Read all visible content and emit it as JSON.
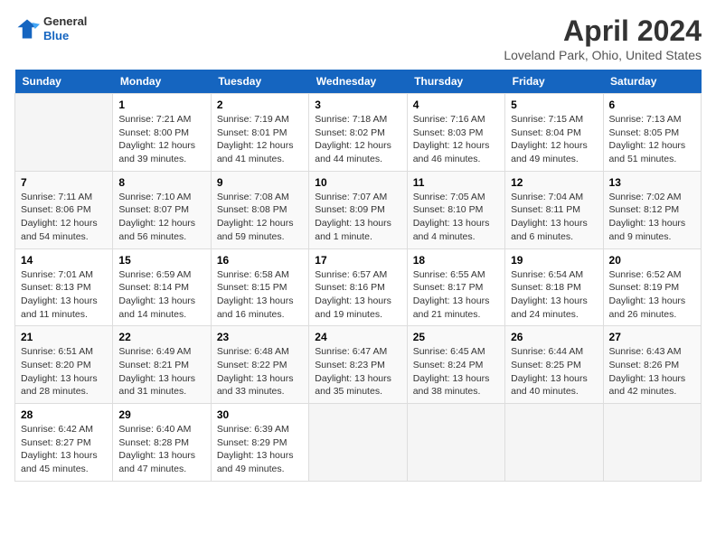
{
  "header": {
    "logo_general": "General",
    "logo_blue": "Blue",
    "title": "April 2024",
    "subtitle": "Loveland Park, Ohio, United States"
  },
  "days_of_week": [
    "Sunday",
    "Monday",
    "Tuesday",
    "Wednesday",
    "Thursday",
    "Friday",
    "Saturday"
  ],
  "weeks": [
    [
      {
        "day": "",
        "sunrise": "",
        "sunset": "",
        "daylight": ""
      },
      {
        "day": "1",
        "sunrise": "Sunrise: 7:21 AM",
        "sunset": "Sunset: 8:00 PM",
        "daylight": "Daylight: 12 hours and 39 minutes."
      },
      {
        "day": "2",
        "sunrise": "Sunrise: 7:19 AM",
        "sunset": "Sunset: 8:01 PM",
        "daylight": "Daylight: 12 hours and 41 minutes."
      },
      {
        "day": "3",
        "sunrise": "Sunrise: 7:18 AM",
        "sunset": "Sunset: 8:02 PM",
        "daylight": "Daylight: 12 hours and 44 minutes."
      },
      {
        "day": "4",
        "sunrise": "Sunrise: 7:16 AM",
        "sunset": "Sunset: 8:03 PM",
        "daylight": "Daylight: 12 hours and 46 minutes."
      },
      {
        "day": "5",
        "sunrise": "Sunrise: 7:15 AM",
        "sunset": "Sunset: 8:04 PM",
        "daylight": "Daylight: 12 hours and 49 minutes."
      },
      {
        "day": "6",
        "sunrise": "Sunrise: 7:13 AM",
        "sunset": "Sunset: 8:05 PM",
        "daylight": "Daylight: 12 hours and 51 minutes."
      }
    ],
    [
      {
        "day": "7",
        "sunrise": "Sunrise: 7:11 AM",
        "sunset": "Sunset: 8:06 PM",
        "daylight": "Daylight: 12 hours and 54 minutes."
      },
      {
        "day": "8",
        "sunrise": "Sunrise: 7:10 AM",
        "sunset": "Sunset: 8:07 PM",
        "daylight": "Daylight: 12 hours and 56 minutes."
      },
      {
        "day": "9",
        "sunrise": "Sunrise: 7:08 AM",
        "sunset": "Sunset: 8:08 PM",
        "daylight": "Daylight: 12 hours and 59 minutes."
      },
      {
        "day": "10",
        "sunrise": "Sunrise: 7:07 AM",
        "sunset": "Sunset: 8:09 PM",
        "daylight": "Daylight: 13 hours and 1 minute."
      },
      {
        "day": "11",
        "sunrise": "Sunrise: 7:05 AM",
        "sunset": "Sunset: 8:10 PM",
        "daylight": "Daylight: 13 hours and 4 minutes."
      },
      {
        "day": "12",
        "sunrise": "Sunrise: 7:04 AM",
        "sunset": "Sunset: 8:11 PM",
        "daylight": "Daylight: 13 hours and 6 minutes."
      },
      {
        "day": "13",
        "sunrise": "Sunrise: 7:02 AM",
        "sunset": "Sunset: 8:12 PM",
        "daylight": "Daylight: 13 hours and 9 minutes."
      }
    ],
    [
      {
        "day": "14",
        "sunrise": "Sunrise: 7:01 AM",
        "sunset": "Sunset: 8:13 PM",
        "daylight": "Daylight: 13 hours and 11 minutes."
      },
      {
        "day": "15",
        "sunrise": "Sunrise: 6:59 AM",
        "sunset": "Sunset: 8:14 PM",
        "daylight": "Daylight: 13 hours and 14 minutes."
      },
      {
        "day": "16",
        "sunrise": "Sunrise: 6:58 AM",
        "sunset": "Sunset: 8:15 PM",
        "daylight": "Daylight: 13 hours and 16 minutes."
      },
      {
        "day": "17",
        "sunrise": "Sunrise: 6:57 AM",
        "sunset": "Sunset: 8:16 PM",
        "daylight": "Daylight: 13 hours and 19 minutes."
      },
      {
        "day": "18",
        "sunrise": "Sunrise: 6:55 AM",
        "sunset": "Sunset: 8:17 PM",
        "daylight": "Daylight: 13 hours and 21 minutes."
      },
      {
        "day": "19",
        "sunrise": "Sunrise: 6:54 AM",
        "sunset": "Sunset: 8:18 PM",
        "daylight": "Daylight: 13 hours and 24 minutes."
      },
      {
        "day": "20",
        "sunrise": "Sunrise: 6:52 AM",
        "sunset": "Sunset: 8:19 PM",
        "daylight": "Daylight: 13 hours and 26 minutes."
      }
    ],
    [
      {
        "day": "21",
        "sunrise": "Sunrise: 6:51 AM",
        "sunset": "Sunset: 8:20 PM",
        "daylight": "Daylight: 13 hours and 28 minutes."
      },
      {
        "day": "22",
        "sunrise": "Sunrise: 6:49 AM",
        "sunset": "Sunset: 8:21 PM",
        "daylight": "Daylight: 13 hours and 31 minutes."
      },
      {
        "day": "23",
        "sunrise": "Sunrise: 6:48 AM",
        "sunset": "Sunset: 8:22 PM",
        "daylight": "Daylight: 13 hours and 33 minutes."
      },
      {
        "day": "24",
        "sunrise": "Sunrise: 6:47 AM",
        "sunset": "Sunset: 8:23 PM",
        "daylight": "Daylight: 13 hours and 35 minutes."
      },
      {
        "day": "25",
        "sunrise": "Sunrise: 6:45 AM",
        "sunset": "Sunset: 8:24 PM",
        "daylight": "Daylight: 13 hours and 38 minutes."
      },
      {
        "day": "26",
        "sunrise": "Sunrise: 6:44 AM",
        "sunset": "Sunset: 8:25 PM",
        "daylight": "Daylight: 13 hours and 40 minutes."
      },
      {
        "day": "27",
        "sunrise": "Sunrise: 6:43 AM",
        "sunset": "Sunset: 8:26 PM",
        "daylight": "Daylight: 13 hours and 42 minutes."
      }
    ],
    [
      {
        "day": "28",
        "sunrise": "Sunrise: 6:42 AM",
        "sunset": "Sunset: 8:27 PM",
        "daylight": "Daylight: 13 hours and 45 minutes."
      },
      {
        "day": "29",
        "sunrise": "Sunrise: 6:40 AM",
        "sunset": "Sunset: 8:28 PM",
        "daylight": "Daylight: 13 hours and 47 minutes."
      },
      {
        "day": "30",
        "sunrise": "Sunrise: 6:39 AM",
        "sunset": "Sunset: 8:29 PM",
        "daylight": "Daylight: 13 hours and 49 minutes."
      },
      {
        "day": "",
        "sunrise": "",
        "sunset": "",
        "daylight": ""
      },
      {
        "day": "",
        "sunrise": "",
        "sunset": "",
        "daylight": ""
      },
      {
        "day": "",
        "sunrise": "",
        "sunset": "",
        "daylight": ""
      },
      {
        "day": "",
        "sunrise": "",
        "sunset": "",
        "daylight": ""
      }
    ]
  ]
}
